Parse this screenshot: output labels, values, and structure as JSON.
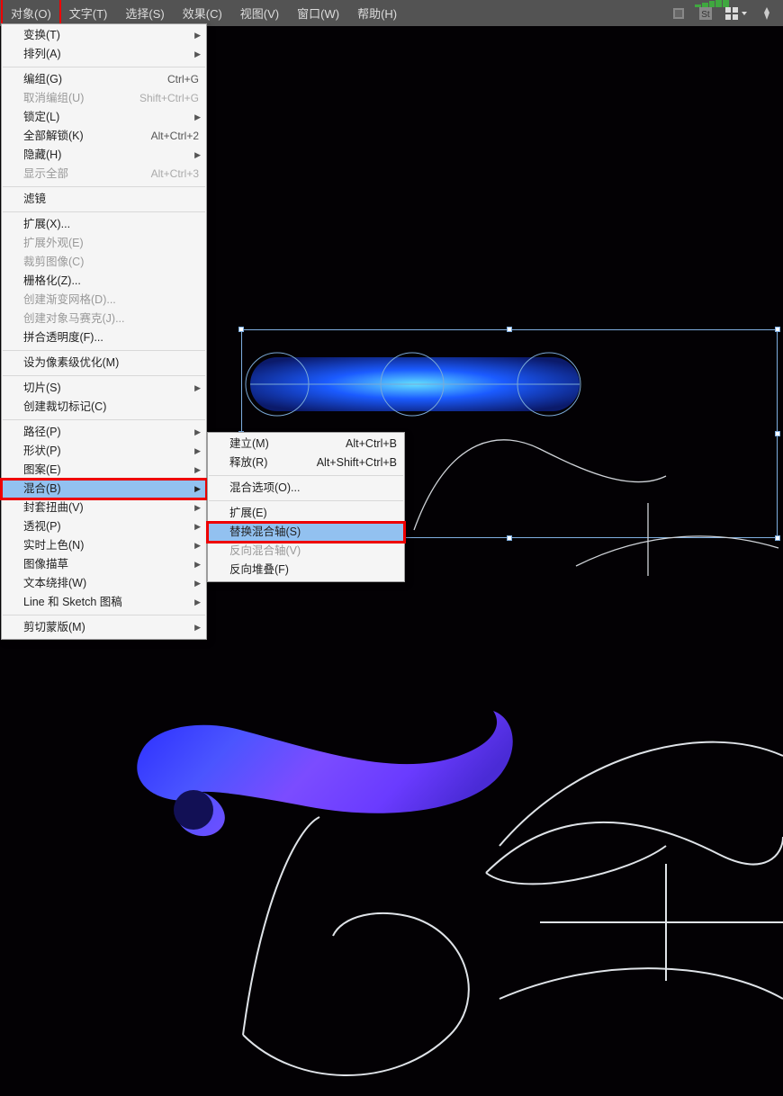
{
  "menubar": {
    "items": [
      "对象(O)",
      "文字(T)",
      "选择(S)",
      "效果(C)",
      "视图(V)",
      "窗口(W)",
      "帮助(H)"
    ]
  },
  "dropdown": [
    {
      "type": "item",
      "label": "变换(T)",
      "arrow": true
    },
    {
      "type": "item",
      "label": "排列(A)",
      "arrow": true
    },
    {
      "type": "sep"
    },
    {
      "type": "item",
      "label": "编组(G)",
      "shortcut": "Ctrl+G"
    },
    {
      "type": "item",
      "label": "取消编组(U)",
      "shortcut": "Shift+Ctrl+G",
      "disabled": true
    },
    {
      "type": "item",
      "label": "锁定(L)",
      "arrow": true
    },
    {
      "type": "item",
      "label": "全部解锁(K)",
      "shortcut": "Alt+Ctrl+2"
    },
    {
      "type": "item",
      "label": "隐藏(H)",
      "arrow": true
    },
    {
      "type": "item",
      "label": "显示全部",
      "shortcut": "Alt+Ctrl+3",
      "disabled": true
    },
    {
      "type": "sep"
    },
    {
      "type": "item",
      "label": "滤镜"
    },
    {
      "type": "sep"
    },
    {
      "type": "item",
      "label": "扩展(X)..."
    },
    {
      "type": "item",
      "label": "扩展外观(E)",
      "disabled": true
    },
    {
      "type": "item",
      "label": "裁剪图像(C)",
      "disabled": true
    },
    {
      "type": "item",
      "label": "栅格化(Z)..."
    },
    {
      "type": "item",
      "label": "创建渐变网格(D)...",
      "disabled": true
    },
    {
      "type": "item",
      "label": "创建对象马赛克(J)...",
      "disabled": true
    },
    {
      "type": "item",
      "label": "拼合透明度(F)..."
    },
    {
      "type": "sep"
    },
    {
      "type": "item",
      "label": "设为像素级优化(M)"
    },
    {
      "type": "sep"
    },
    {
      "type": "item",
      "label": "切片(S)",
      "arrow": true
    },
    {
      "type": "item",
      "label": "创建裁切标记(C)"
    },
    {
      "type": "sep"
    },
    {
      "type": "item",
      "label": "路径(P)",
      "arrow": true
    },
    {
      "type": "item",
      "label": "形状(P)",
      "arrow": true
    },
    {
      "type": "item",
      "label": "图案(E)",
      "arrow": true
    },
    {
      "type": "item",
      "label": "混合(B)",
      "arrow": true,
      "hl": true,
      "redbox": true
    },
    {
      "type": "item",
      "label": "封套扭曲(V)",
      "arrow": true
    },
    {
      "type": "item",
      "label": "透视(P)",
      "arrow": true
    },
    {
      "type": "item",
      "label": "实时上色(N)",
      "arrow": true
    },
    {
      "type": "item",
      "label": "图像描草",
      "arrow": true
    },
    {
      "type": "item",
      "label": "文本绕排(W)",
      "arrow": true
    },
    {
      "type": "item",
      "label": "Line 和 Sketch 图稿",
      "arrow": true
    },
    {
      "type": "sep"
    },
    {
      "type": "item",
      "label": "剪切蒙版(M)",
      "arrow": true
    }
  ],
  "submenu": [
    {
      "type": "item",
      "label": "建立(M)",
      "shortcut": "Alt+Ctrl+B"
    },
    {
      "type": "item",
      "label": "释放(R)",
      "shortcut": "Alt+Shift+Ctrl+B"
    },
    {
      "type": "sep"
    },
    {
      "type": "item",
      "label": "混合选项(O)..."
    },
    {
      "type": "sep"
    },
    {
      "type": "item",
      "label": "扩展(E)"
    },
    {
      "type": "item",
      "label": "替换混合轴(S)",
      "hl": true,
      "redbox": true
    },
    {
      "type": "item",
      "label": "反向混合轴(V)",
      "disabled": true
    },
    {
      "type": "item",
      "label": "反向堆叠(F)"
    }
  ]
}
